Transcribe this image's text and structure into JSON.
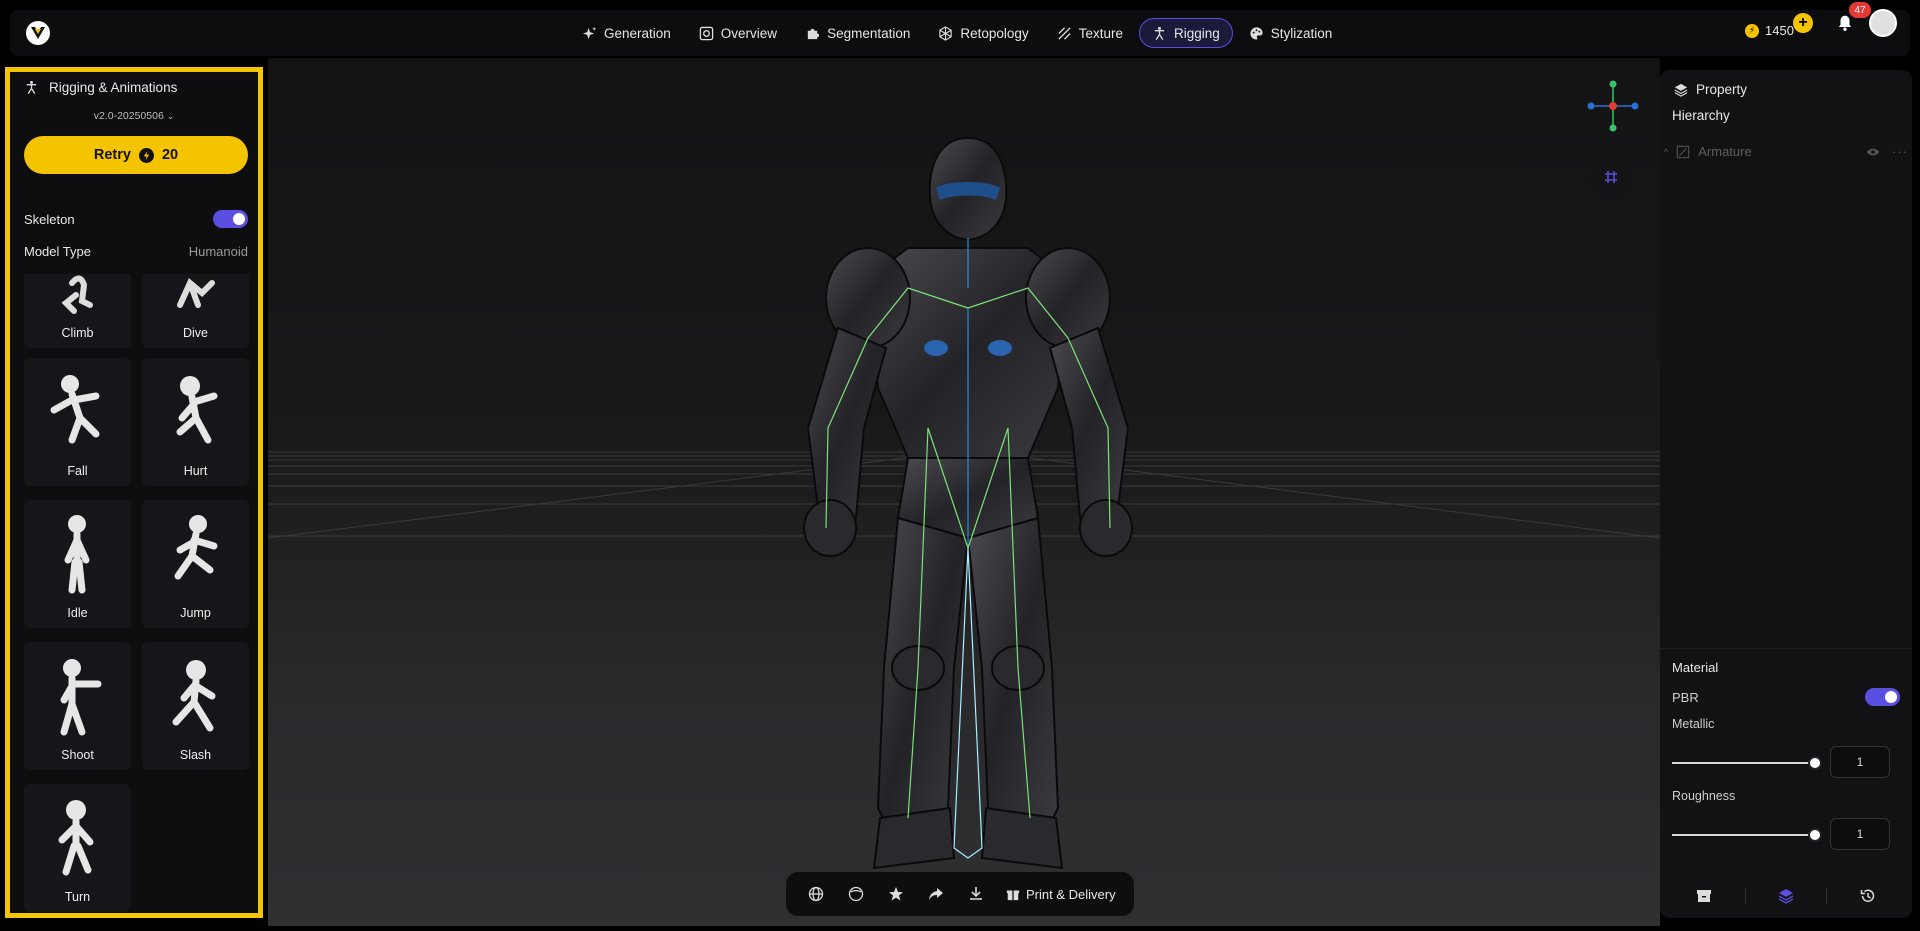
{
  "nav": {
    "items": [
      {
        "label": "Generation",
        "icon": "sparkle-icon",
        "active": false
      },
      {
        "label": "Overview",
        "icon": "overview-icon",
        "active": false
      },
      {
        "label": "Segmentation",
        "icon": "puzzle-icon",
        "active": false
      },
      {
        "label": "Retopology",
        "icon": "mesh-icon",
        "active": false
      },
      {
        "label": "Texture",
        "icon": "texture-icon",
        "active": false
      },
      {
        "label": "Rigging",
        "icon": "rigging-icon",
        "active": true
      },
      {
        "label": "Stylization",
        "icon": "palette-icon",
        "active": false
      }
    ]
  },
  "account": {
    "credits": "1450",
    "notification_count": "47"
  },
  "left_panel": {
    "title": "Rigging & Animations",
    "version": "v2.0-20250506",
    "retry_label": "Retry",
    "retry_cost": "20",
    "skeleton_label": "Skeleton",
    "skeleton_on": true,
    "model_type_label": "Model Type",
    "model_type_value": "Humanoid",
    "animations": [
      "Climb",
      "Dive",
      "Fall",
      "Hurt",
      "Idle",
      "Jump",
      "Shoot",
      "Slash",
      "Turn"
    ]
  },
  "toolbar": {
    "print_label": "Print & Delivery"
  },
  "right_panel": {
    "title": "Property",
    "hierarchy_label": "Hierarchy",
    "armature_label": "Armature",
    "material_label": "Material",
    "pbr_label": "PBR",
    "pbr_on": true,
    "metallic_label": "Metallic",
    "metallic_value": "1",
    "roughness_label": "Roughness",
    "roughness_value": "1"
  },
  "colors": {
    "accent_yellow": "#f5c400",
    "accent_purple": "#5a4fe0",
    "badge_red": "#e53935"
  }
}
